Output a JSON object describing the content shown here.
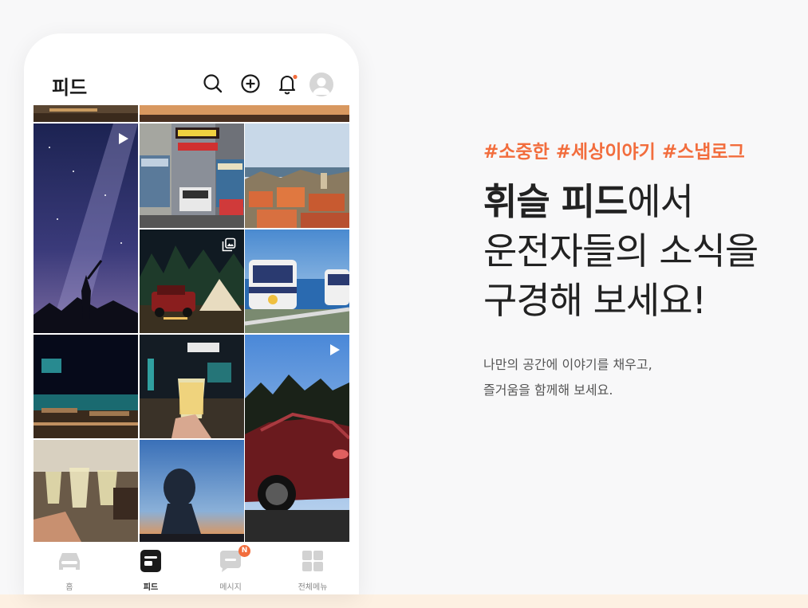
{
  "header": {
    "title": "피드",
    "icons": [
      "search-icon",
      "add-circle-icon",
      "bell-icon",
      "profile-avatar"
    ],
    "notification_dot_color": "#f26d3d"
  },
  "feed": {
    "tiles": [
      {
        "subject": "Milky way night sky with silhouette",
        "badge": "play-icon"
      },
      {
        "subject": "Hong Kong street with trams"
      },
      {
        "subject": "Coastal old town rooftops"
      },
      {
        "subject": "Camping with SUV and tent at night",
        "badge": "gallery-icon"
      },
      {
        "subject": "Blue sky capsule train by the sea"
      },
      {
        "subject": "Night cafe terrace by the water"
      },
      {
        "subject": "Cocktail glass at night market"
      },
      {
        "subject": "Red sports car under sky",
        "badge": "play-icon"
      },
      {
        "subject": "Wine glasses toast"
      },
      {
        "subject": "Statue at sunset"
      }
    ]
  },
  "nav": {
    "items": [
      {
        "label": "홈",
        "icon": "car-icon"
      },
      {
        "label": "피드",
        "icon": "feed-icon",
        "active": true
      },
      {
        "label": "메시지",
        "icon": "message-icon",
        "badge": "N"
      },
      {
        "label": "전체메뉴",
        "icon": "grid-menu-icon"
      }
    ]
  },
  "promo": {
    "hashtags": "#소중한 #세상이야기 #스냅로그",
    "headline_bold": "휘슬 피드",
    "headline_line1_rest": "에서",
    "headline_line2": "운전자들의 소식을",
    "headline_line3": "구경해 보세요!",
    "subtext_line1": "나만의 공간에 이야기를 채우고,",
    "subtext_line2": "즐거움을 함께해 보세요."
  },
  "colors": {
    "accent": "#f26d3d",
    "background": "#f8f8f9",
    "bottom_strip": "#fdf0e2"
  }
}
